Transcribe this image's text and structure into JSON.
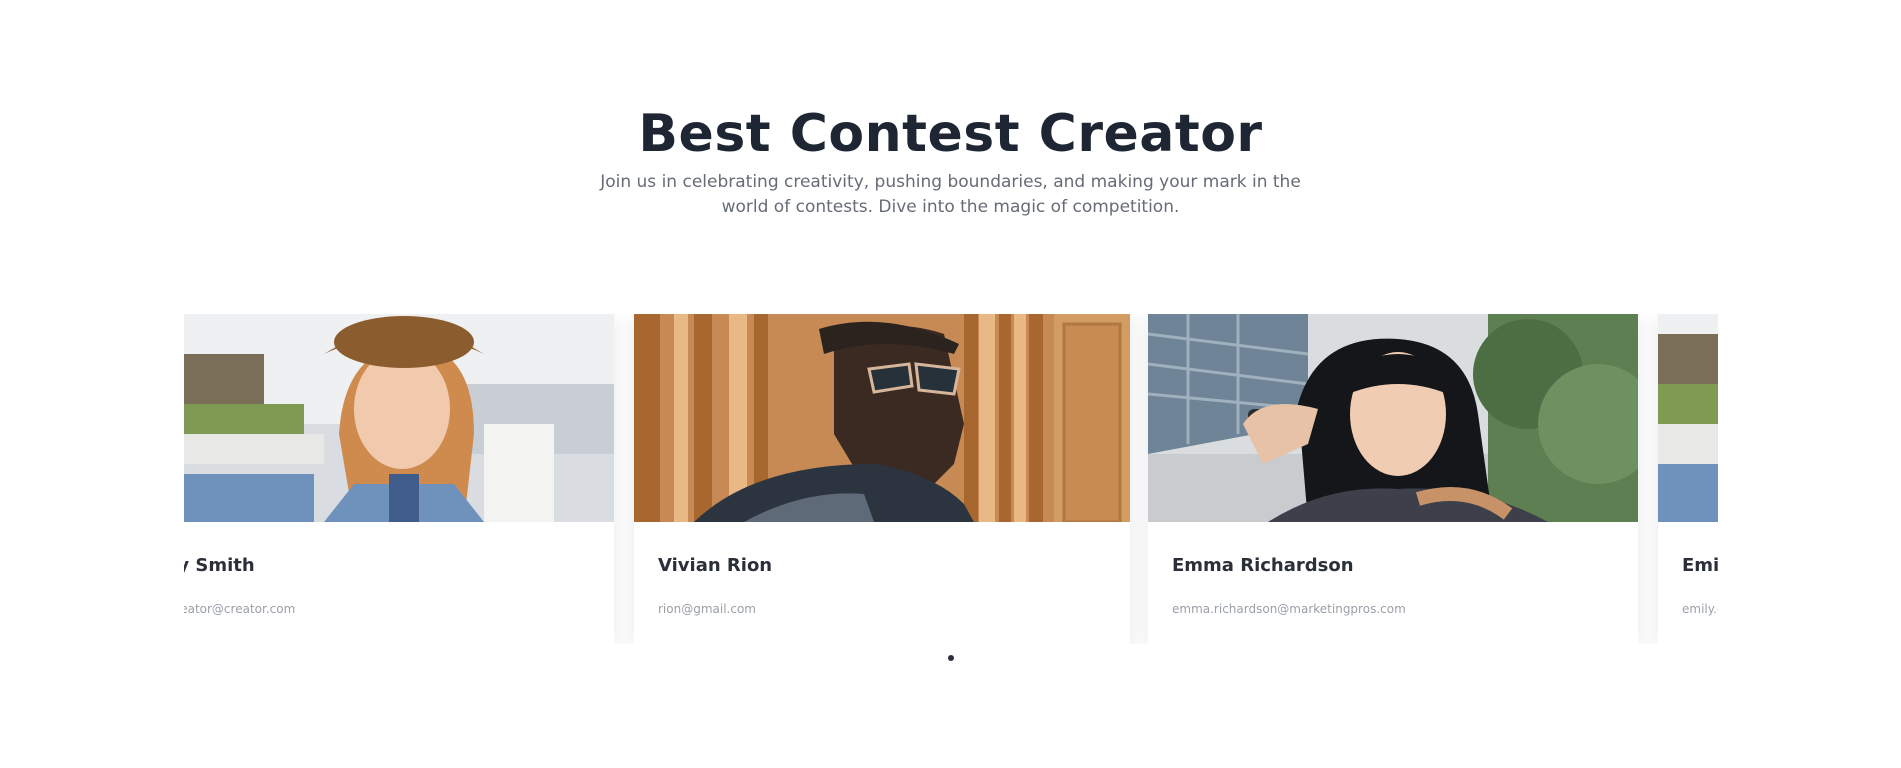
{
  "section": {
    "title": "Best Contest Creator",
    "subtitle": "Join us in celebrating creativity, pushing boundaries, and making your mark in the world of contests. Dive into the magic of competition."
  },
  "cards": [
    {
      "name": "Emily Smith",
      "email": "emily.creator@creator.com",
      "photo": "woman-in-hat-selfie-photo"
    },
    {
      "name": "Vivian Rion",
      "email": "rion@gmail.com",
      "photo": "man-in-sunglasses-photo"
    },
    {
      "name": "Emma Richardson",
      "email": "emma.richardson@marketingpros.com",
      "photo": "woman-with-bangs-photo"
    },
    {
      "name": "Emily Smith",
      "email": "emily.creator@creator.com",
      "photo": "woman-in-hat-selfie-photo"
    }
  ],
  "pagination": {
    "active_index": 0,
    "count": 1
  }
}
